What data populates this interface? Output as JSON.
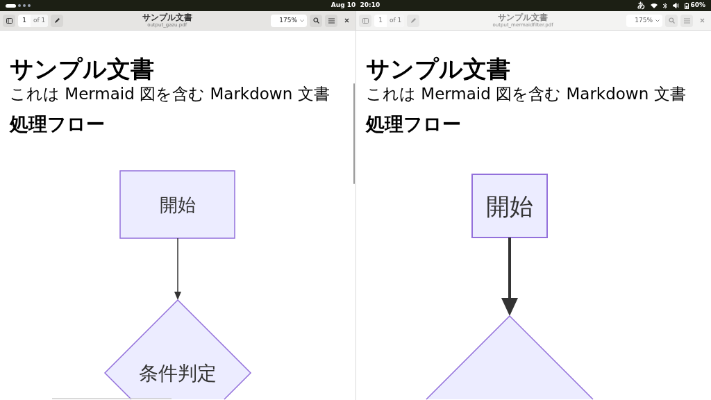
{
  "top_bar": {
    "clock": "Aug 10  20:10",
    "input_method": "あ",
    "battery": "60%"
  },
  "windows": [
    {
      "title": "サンプル文書",
      "filename": "output_gazu.pdf",
      "page": "1",
      "page_total": "of 1",
      "zoom": "175%",
      "active": true,
      "document": {
        "heading": "サンプル文書",
        "paragraph": "これは Mermaid 図を含む Markdown 文書",
        "section": "処理フロー",
        "flowchart": [
          {
            "kind": "process",
            "label": "開始"
          },
          {
            "kind": "decision",
            "label": "条件判定"
          }
        ]
      }
    },
    {
      "title": "サンプル文書",
      "filename": "output_mermaidfilter.pdf",
      "page": "1",
      "page_total": "of 1",
      "zoom": "175%",
      "active": false,
      "document": {
        "heading": "サンプル文書",
        "paragraph": "これは Mermaid 図を含む Markdown 文書",
        "section": "処理フロー",
        "flowchart": [
          {
            "kind": "process",
            "label": "開始"
          },
          {
            "kind": "decision"
          }
        ]
      }
    }
  ]
}
